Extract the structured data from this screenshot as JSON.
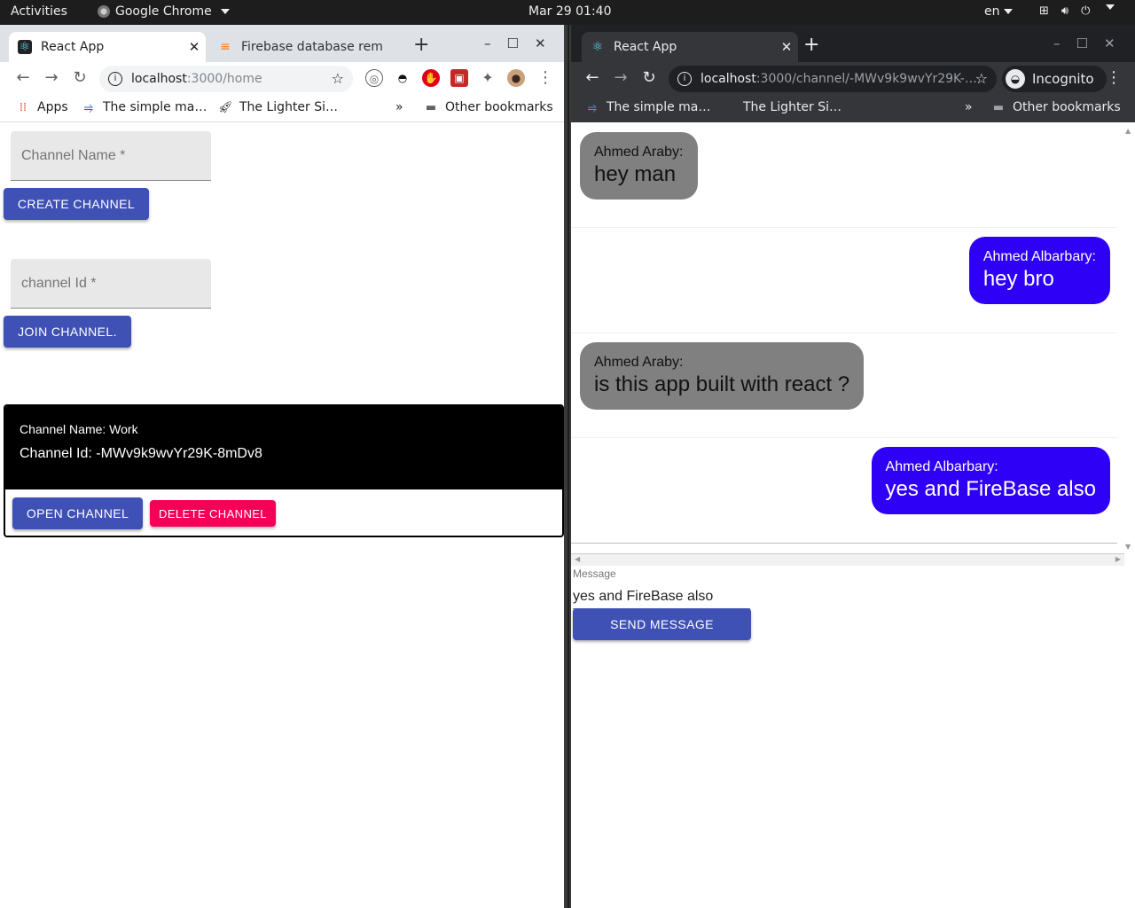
{
  "topbar": {
    "activities": "Activities",
    "app_name": "Google Chrome",
    "clock": "Mar 29  01:40",
    "lang": "en"
  },
  "left_window": {
    "tabs": [
      {
        "title": "React App",
        "icon": "react-icon",
        "active": true
      },
      {
        "title": "Firebase database rem",
        "icon": "stackoverflow-icon",
        "active": false
      }
    ],
    "url_host": "localhost",
    "url_path": ":3000/home",
    "bookmarks": {
      "apps": "Apps",
      "b1": "The simple ma…",
      "b2": "The Lighter Si…",
      "more": "»",
      "other": "Other bookmarks"
    },
    "app": {
      "channel_name_placeholder": "Channel Name *",
      "create_label": "CREATE CHANNEL",
      "channel_id_placeholder": "channel Id *",
      "join_label": "JOIN CHANNEL.",
      "card": {
        "name_line": "Channel Name: Work",
        "id_line": "Channel Id: -MWv9k9wvYr29K-8mDv8",
        "open_label": "OPEN CHANNEL",
        "delete_label": "DELETE CHANNEL"
      }
    }
  },
  "right_window": {
    "tab_title": "React App",
    "url_host": "localhost",
    "url_path": ":3000/channel/-MWv9k9wvYr29K-…",
    "incognito": "Incognito",
    "bookmarks": {
      "b1": "The simple ma…",
      "b2": "The Lighter Si…",
      "more": "»",
      "other": "Other bookmarks"
    },
    "messages": [
      {
        "author": "Ahmed Araby:",
        "text": "hey man",
        "mine": false
      },
      {
        "author": "Ahmed Albarbary:",
        "text": "hey bro",
        "mine": true
      },
      {
        "author": "Ahmed Araby:",
        "text": "is this app built with react ?",
        "mine": false
      },
      {
        "author": "Ahmed Albarbary:",
        "text": "yes and FireBase also",
        "mine": true
      }
    ],
    "message_label": "Message",
    "message_value": "yes and FireBase also",
    "send_label": "SEND MESSAGE"
  },
  "colors": {
    "primary": "#3f51b5",
    "danger": "#f50057",
    "mine_bubble": "#2e00f5",
    "other_bubble": "#808080"
  }
}
